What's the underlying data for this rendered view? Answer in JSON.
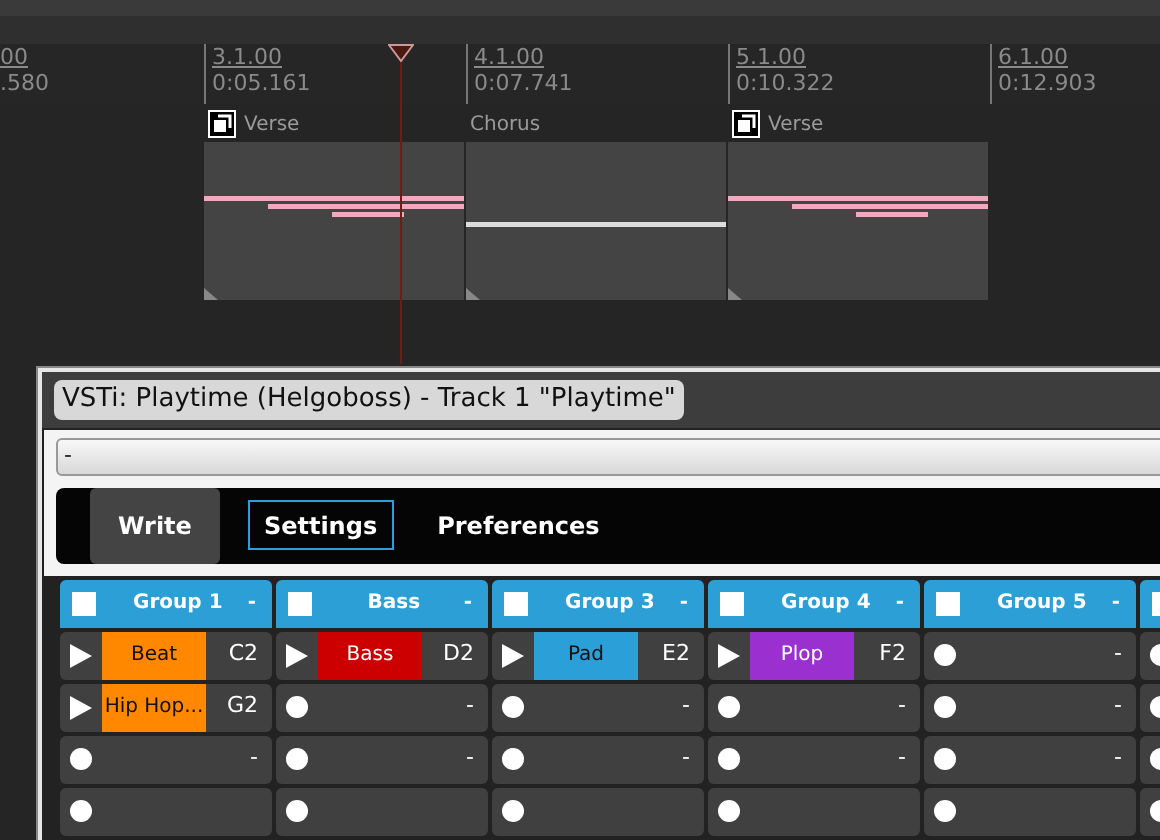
{
  "ruler": {
    "markers": [
      {
        "bar": "00",
        "time": ".580"
      },
      {
        "bar": "3.1.00",
        "time": "0:05.161"
      },
      {
        "bar": "4.1.00",
        "time": "0:07.741"
      },
      {
        "bar": "5.1.00",
        "time": "0:10.322"
      },
      {
        "bar": "6.1.00",
        "time": "0:12.903"
      }
    ]
  },
  "regions": [
    {
      "label": "Verse",
      "looped": true,
      "kind": "chords"
    },
    {
      "label": "Chorus",
      "looped": false,
      "kind": "sustain"
    },
    {
      "label": "Verse",
      "looped": true,
      "kind": "chords"
    }
  ],
  "plugin_window": {
    "title": "VSTi: Playtime (Helgoboss) - Track 1 \"Playtime\"",
    "preset": "-",
    "toolbar": [
      {
        "label": "Write",
        "kind": "button",
        "selected": false
      },
      {
        "label": "Settings",
        "kind": "tab",
        "selected": true
      },
      {
        "label": "Preferences",
        "kind": "tab",
        "selected": false
      }
    ],
    "groups": [
      {
        "name": "Group 1",
        "checked": false,
        "trigger": "-",
        "slots": [
          {
            "kind": "clip",
            "name": "Beat",
            "color": "#ff8800",
            "note": "C2"
          },
          {
            "kind": "clip",
            "name": "Hip Hop...",
            "color": "#ff8800",
            "note": "G2"
          },
          {
            "kind": "empty",
            "note": "-"
          },
          {
            "kind": "empty"
          }
        ]
      },
      {
        "name": "Bass",
        "checked": false,
        "trigger": "-",
        "slots": [
          {
            "kind": "clip",
            "name": "Bass",
            "color": "#cc0000",
            "note": "D2"
          },
          {
            "kind": "empty",
            "note": "-"
          },
          {
            "kind": "empty",
            "note": "-"
          },
          {
            "kind": "empty"
          }
        ]
      },
      {
        "name": "Group 3",
        "checked": false,
        "trigger": "-",
        "slots": [
          {
            "kind": "clip",
            "name": "Pad",
            "color": "#2ba0d8",
            "note": "E2"
          },
          {
            "kind": "empty",
            "note": "-"
          },
          {
            "kind": "empty",
            "note": "-"
          },
          {
            "kind": "empty"
          }
        ]
      },
      {
        "name": "Group 4",
        "checked": false,
        "trigger": "-",
        "slots": [
          {
            "kind": "clip",
            "name": "Plop",
            "color": "#9b30d0",
            "note": "F2"
          },
          {
            "kind": "empty",
            "note": "-"
          },
          {
            "kind": "empty",
            "note": "-"
          },
          {
            "kind": "empty"
          }
        ]
      },
      {
        "name": "Group 5",
        "checked": false,
        "trigger": "-",
        "slots": [
          {
            "kind": "empty",
            "note": "-"
          },
          {
            "kind": "empty",
            "note": "-"
          },
          {
            "kind": "empty",
            "note": "-"
          },
          {
            "kind": "empty"
          }
        ]
      },
      {
        "checked": false,
        "slots": [
          {
            "kind": "empty"
          },
          {
            "kind": "empty"
          },
          {
            "kind": "empty"
          },
          {
            "kind": "empty"
          }
        ]
      }
    ]
  }
}
